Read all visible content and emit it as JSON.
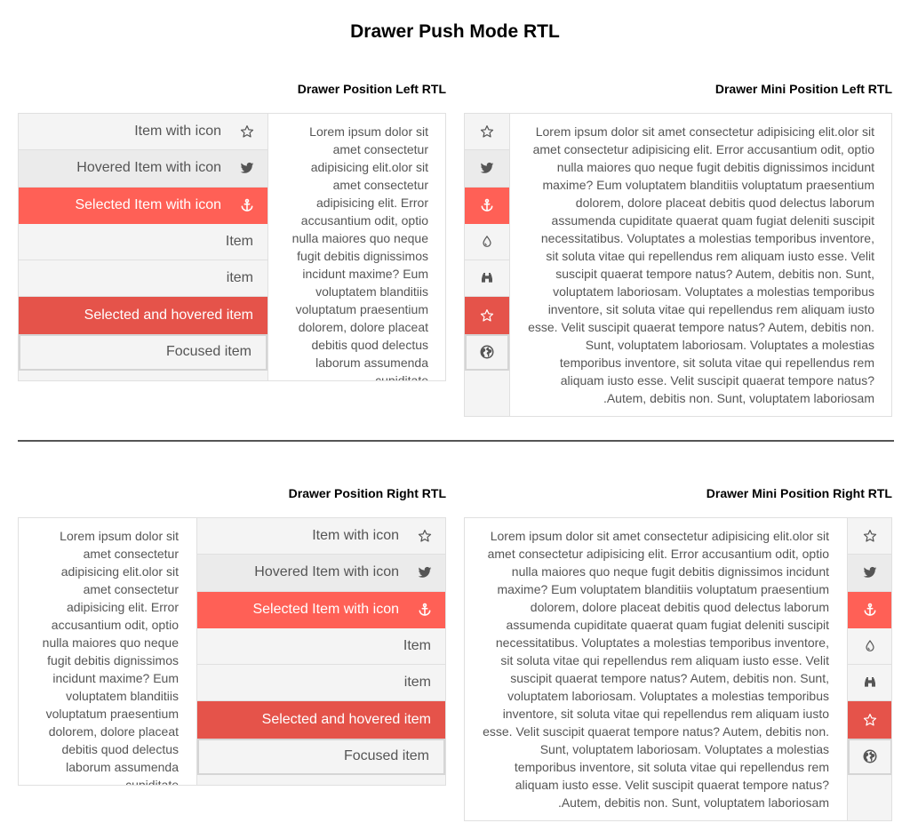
{
  "page": {
    "title": "Drawer Push Mode RTL"
  },
  "demos": {
    "left": {
      "title": "Drawer Position Left RTL"
    },
    "mini_left": {
      "title": "Drawer Mini Position Left RTL"
    },
    "right": {
      "title": "Drawer Position Right RTL"
    },
    "mini_right": {
      "title": "Drawer Mini Position Right RTL"
    }
  },
  "items": [
    {
      "label": "Item with icon",
      "icon": "star-outline-icon",
      "state": "normal"
    },
    {
      "label": "Hovered Item with icon",
      "icon": "twitter-icon",
      "state": "hovered"
    },
    {
      "label": "Selected Item with icon",
      "icon": "anchor-icon",
      "state": "selected"
    },
    {
      "label": "Item",
      "icon": "drop-icon",
      "state": "normal"
    },
    {
      "label": "item",
      "icon": "binoculars-icon",
      "state": "normal"
    },
    {
      "label": "Selected and hovered item",
      "icon": "star-outline-icon",
      "state": "selected-hovered"
    },
    {
      "label": "Focused item",
      "icon": "globe-icon",
      "state": "focused"
    }
  ],
  "content": {
    "narrow": "Lorem ipsum dolor sit amet consectetur adipisicing elit.olor sit amet consectetur adipisicing elit. Error accusantium odit, optio nulla maiores quo neque fugit debitis dignissimos incidunt maxime? Eum voluptatem blanditiis voluptatum praesentium dolorem, dolore placeat debitis quod delectus laborum assumenda cupiditate.",
    "wide": "Lorem ipsum dolor sit amet consectetur adipisicing elit.olor sit amet consectetur adipisicing elit. Error accusantium odit, optio nulla maiores quo neque fugit debitis dignissimos incidunt maxime? Eum voluptatem blanditiis voluptatum praesentium dolorem, dolore placeat debitis quod delectus laborum assumenda cupiditate quaerat quam fugiat deleniti suscipit necessitatibus. Voluptates a molestias temporibus inventore, sit soluta vitae qui repellendus rem aliquam iusto esse. Velit suscipit quaerat tempore natus? Autem, debitis non. Sunt, voluptatem laboriosam. Voluptates a molestias temporibus inventore, sit soluta vitae qui repellendus rem aliquam iusto esse. Velit suscipit quaerat tempore natus? Autem, debitis non. Sunt, voluptatem laboriosam. Voluptates a molestias temporibus inventore, sit soluta vitae qui repellendus rem aliquam iusto esse. Velit suscipit quaerat tempore natus? Autem, debitis non. Sunt, voluptatem laboriosam."
  },
  "colors": {
    "selected": "#ff6056",
    "selected_hovered": "#e5534a",
    "drawer_bg": "#f4f4f4",
    "hovered_bg": "#ebebeb"
  }
}
